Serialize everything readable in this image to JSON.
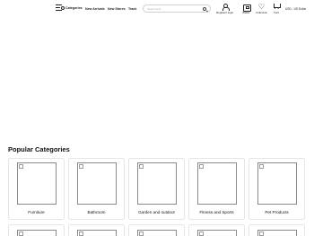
{
  "header": {
    "categories_label": "Categories",
    "nav": [
      "New Arrivals",
      "New Stores",
      "Track"
    ],
    "search_placeholder": "Search text",
    "account_label": "Register/ login",
    "wallet_label": "Wallet",
    "collection_label": "Collection",
    "cart_label": "Cart",
    "currency_language": "USD - US Dollar"
  },
  "popular": {
    "title": "Popular Categories",
    "items": [
      {
        "label": "Furniture"
      },
      {
        "label": "Bathroom"
      },
      {
        "label": "Garden and outdoor"
      },
      {
        "label": "Fitness and Sports"
      },
      {
        "label": "Pet Products"
      }
    ]
  }
}
